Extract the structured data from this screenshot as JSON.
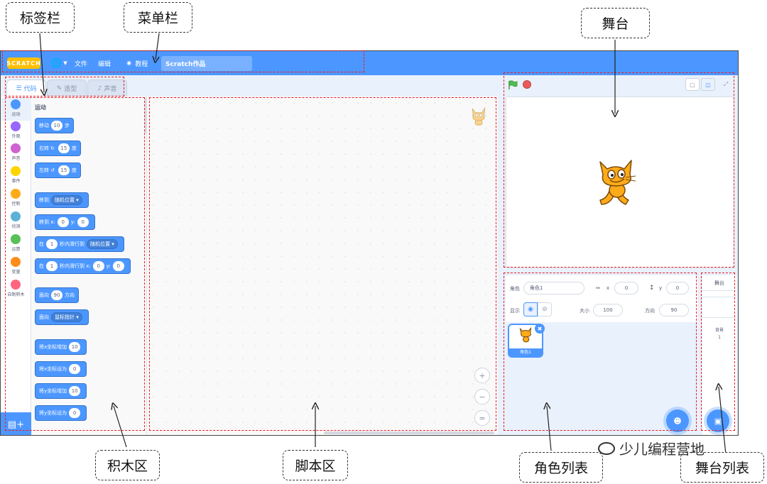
{
  "annotations": {
    "tab_bar": "标签栏",
    "menu_bar": "菜单栏",
    "stage": "舞台",
    "block_area": "积木区",
    "script_area": "脚本区",
    "sprite_list": "角色列表",
    "stage_list": "舞台列表",
    "watermark": "少儿编程营地"
  },
  "menubar": {
    "logo": "SCRATCH",
    "file": "文件",
    "edit": "编辑",
    "tutorials": "教程",
    "project_title": "Scratch作品"
  },
  "tabs": [
    {
      "label": "代码"
    },
    {
      "label": "造型"
    },
    {
      "label": "声音"
    }
  ],
  "categories": [
    {
      "label": "运动",
      "color": "#4c97ff"
    },
    {
      "label": "外观",
      "color": "#9966ff"
    },
    {
      "label": "声音",
      "color": "#cf63cf"
    },
    {
      "label": "事件",
      "color": "#ffd500"
    },
    {
      "label": "控制",
      "color": "#ffab19"
    },
    {
      "label": "侦测",
      "color": "#5cb1d6"
    },
    {
      "label": "运算",
      "color": "#59c059"
    },
    {
      "label": "变量",
      "color": "#ff8c1a"
    },
    {
      "label": "自制积木",
      "color": "#ff6680"
    }
  ],
  "palette": {
    "title": "运动",
    "blocks": {
      "move_a": "移动",
      "move_v": "10",
      "move_b": "步",
      "turn_r_a": "右转",
      "turn_r_v": "15",
      "turn_r_b": "度",
      "turn_l_a": "左转",
      "turn_l_v": "15",
      "turn_l_b": "度",
      "goto_a": "移到",
      "goto_dd": "随机位置",
      "gotoxy_a": "移到 x:",
      "gotoxy_x": "0",
      "gotoxy_b": "y:",
      "gotoxy_y": "0",
      "glide_a": "在",
      "glide_v": "1",
      "glide_b": "秒内滑行到",
      "glide_dd": "随机位置",
      "glidexy_a": "在",
      "glidexy_v": "1",
      "glidexy_b": "秒内滑行到 x:",
      "glidexy_x": "0",
      "glidexy_c": "y:",
      "glidexy_y": "0",
      "point_a": "面向",
      "point_v": "90",
      "point_b": "方向",
      "pointto_a": "面向",
      "pointto_dd": "鼠标指针",
      "chx_a": "将x坐标增加",
      "chx_v": "10",
      "setx_a": "将x坐标设为",
      "setx_v": "0",
      "chy_a": "将y坐标增加",
      "chy_v": "10",
      "sety_a": "将y坐标设为",
      "sety_v": "0"
    }
  },
  "sprite_info": {
    "sprite_label": "角色",
    "sprite_name": "角色1",
    "x_label": "x",
    "x_value": "0",
    "y_label": "y",
    "y_value": "0",
    "show_label": "显示",
    "size_label": "大小",
    "size_value": "100",
    "direction_label": "方向",
    "direction_value": "90"
  },
  "sprite_card": {
    "name": "角色1"
  },
  "stage_pane": {
    "header": "舞台",
    "backdrop_label": "背景",
    "backdrop_count": "1"
  }
}
